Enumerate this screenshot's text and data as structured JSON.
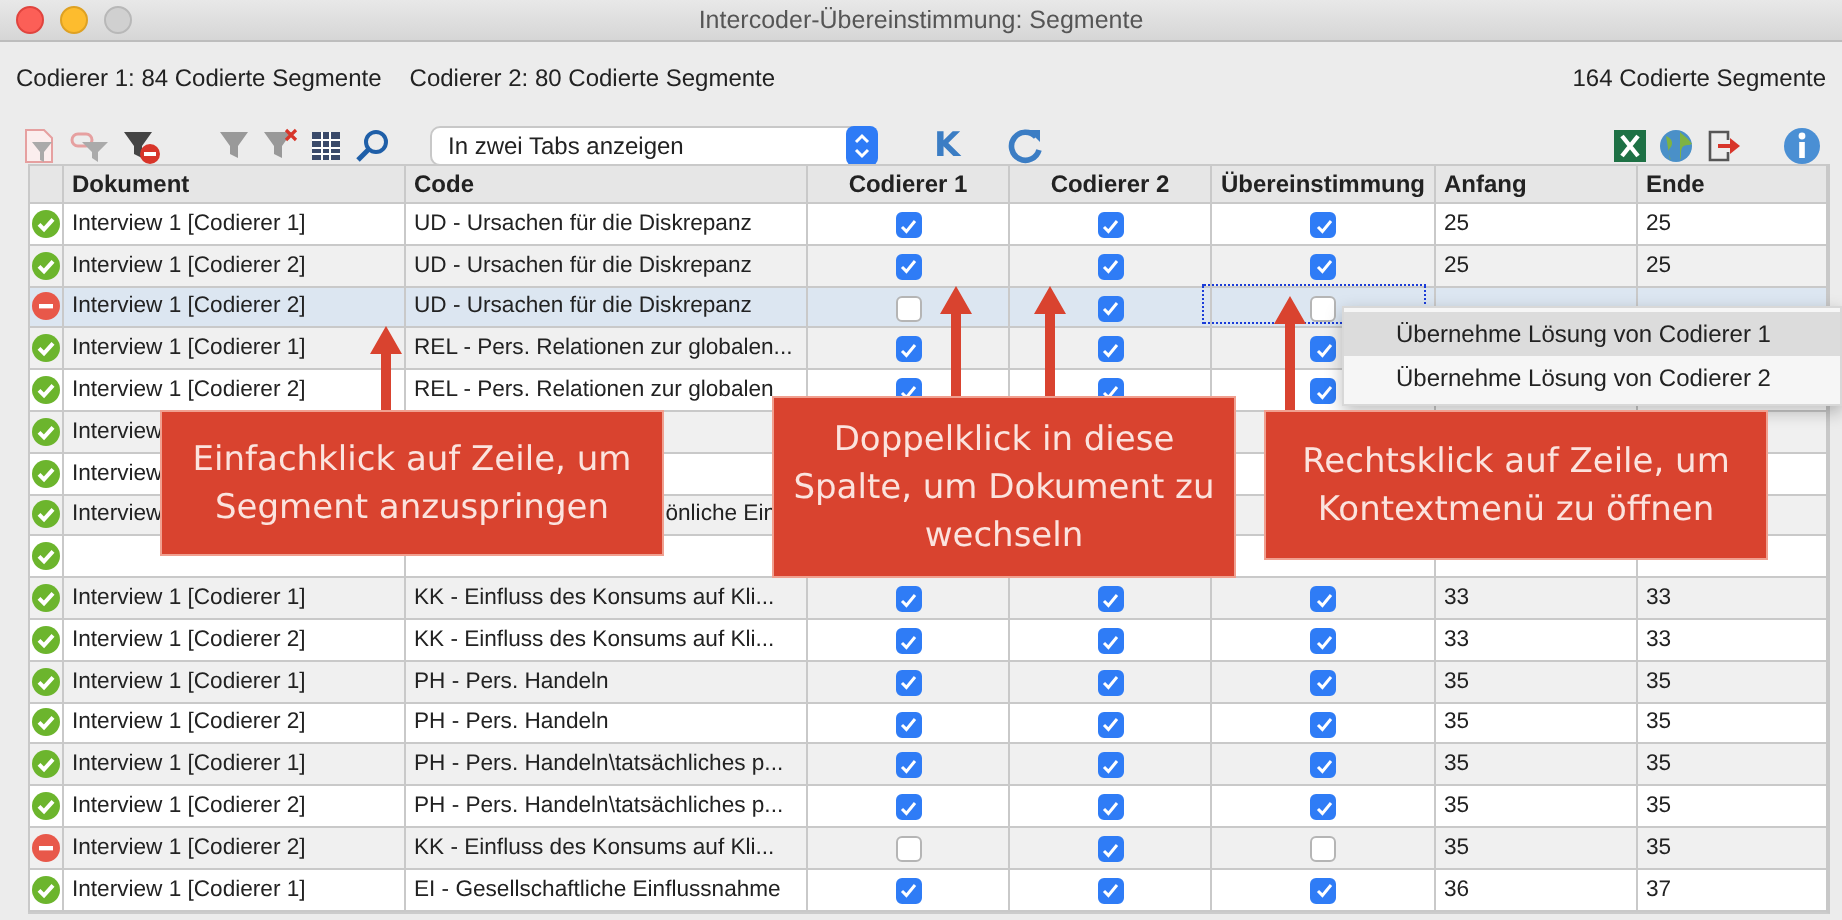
{
  "window": {
    "title": "Intercoder-Übereinstimmung: Segmente"
  },
  "summary": {
    "coder_1": "Codierer 1: 84 Codierte Segmente",
    "coder_2": "Codierer 2: 80 Codierte Segmente",
    "total": "164 Codierte Segmente"
  },
  "toolbar": {
    "view_select": {
      "value": "In zwei Tabs anzeigen"
    },
    "k_button": "K"
  },
  "table": {
    "columns": [
      "Dokument",
      "Code",
      "Codierer 1",
      "Codierer 2",
      "Übereinstimmung",
      "Anfang",
      "Ende"
    ],
    "rows": [
      {
        "kind": "ok",
        "selected": false,
        "document": "Interview 1 [Codierer 1]",
        "code": "UD - Ursachen für die Diskrepanz",
        "coder_1": true,
        "coder_2": true,
        "agreement": true,
        "start": "25",
        "end": "25"
      },
      {
        "kind": "ok",
        "selected": false,
        "document": "Interview 1 [Codierer 2]",
        "code": "UD - Ursachen für die Diskrepanz",
        "coder_1": true,
        "coder_2": true,
        "agreement": true,
        "start": "25",
        "end": "25"
      },
      {
        "kind": "fail",
        "selected": true,
        "document": "Interview 1 [Codierer 2]",
        "code": "UD - Ursachen für die Diskrepanz",
        "coder_1": false,
        "coder_2": true,
        "agreement": false
      },
      {
        "kind": "ok",
        "selected": false,
        "document": "Interview 1 [Codierer 1]",
        "code": "REL - Pers. Relationen zur globalen...",
        "coder_1": true,
        "coder_2": true,
        "agreement": true
      },
      {
        "kind": "ok",
        "selected": false,
        "document": "Interview 1 [Codierer 2]",
        "code": "REL - Pers. Relationen zur globalen",
        "coder_1": true,
        "coder_2": true,
        "agreement": true
      },
      {
        "kind": "ok",
        "selected": false,
        "document": "Interview"
      },
      {
        "kind": "ok",
        "selected": false,
        "document": "Interview"
      },
      {
        "kind": "ok",
        "selected": false,
        "document": "Interview",
        "code": "önliche Ein",
        "code_cut_left": true
      },
      {
        "kind": "ok",
        "selected": false
      },
      {
        "kind": "ok",
        "selected": false,
        "document": "Interview 1 [Codierer 1]",
        "code": "KK - Einfluss des Konsums auf Kli...",
        "coder_1": true,
        "coder_2": true,
        "agreement": true,
        "start": "33",
        "end": "33"
      },
      {
        "kind": "ok",
        "selected": false,
        "document": "Interview 1 [Codierer 2]",
        "code": "KK - Einfluss des Konsums auf Kli...",
        "coder_1": true,
        "coder_2": true,
        "agreement": true,
        "start": "33",
        "end": "33"
      },
      {
        "kind": "ok",
        "selected": false,
        "document": "Interview 1 [Codierer 1]",
        "code": "PH - Pers. Handeln",
        "coder_1": true,
        "coder_2": true,
        "agreement": true,
        "start": "35",
        "end": "35"
      },
      {
        "kind": "ok",
        "selected": false,
        "document": "Interview 1 [Codierer 2]",
        "code": "PH - Pers. Handeln",
        "coder_1": true,
        "coder_2": true,
        "agreement": true,
        "start": "35",
        "end": "35"
      },
      {
        "kind": "ok",
        "selected": false,
        "document": "Interview 1 [Codierer 1]",
        "code": "PH - Pers. Handeln\\tatsächliches p...",
        "coder_1": true,
        "coder_2": true,
        "agreement": true,
        "start": "35",
        "end": "35"
      },
      {
        "kind": "ok",
        "selected": false,
        "document": "Interview 1 [Codierer 2]",
        "code": "PH - Pers. Handeln\\tatsächliches p...",
        "coder_1": true,
        "coder_2": true,
        "agreement": true,
        "start": "35",
        "end": "35"
      },
      {
        "kind": "fail",
        "selected": false,
        "document": "Interview 1 [Codierer 2]",
        "code": "KK - Einfluss des Konsums auf Kli...",
        "coder_1": false,
        "coder_2": true,
        "agreement": false,
        "start": "35",
        "end": "35"
      },
      {
        "kind": "ok",
        "selected": false,
        "document": "Interview 1 [Codierer 1]",
        "code": "EI - Gesellschaftliche Einflussnahme",
        "coder_1": true,
        "coder_2": true,
        "agreement": true,
        "start": "36",
        "end": "37"
      }
    ]
  },
  "context_menu": {
    "items": [
      {
        "label": "Übernehme Lösung von Codierer 1",
        "selected": true
      },
      {
        "label": "Übernehme Lösung von Codierer 2",
        "selected": false
      }
    ]
  },
  "callouts": [
    {
      "text": "Einfachklick auf Zeile, um Segment anzuspringen"
    },
    {
      "text": "Doppelklick in diese Spalte, um Dokument zu wechseln"
    },
    {
      "text": "Rechtsklick auf Zeile, um Kontextmenü zu öffnen"
    }
  ]
}
